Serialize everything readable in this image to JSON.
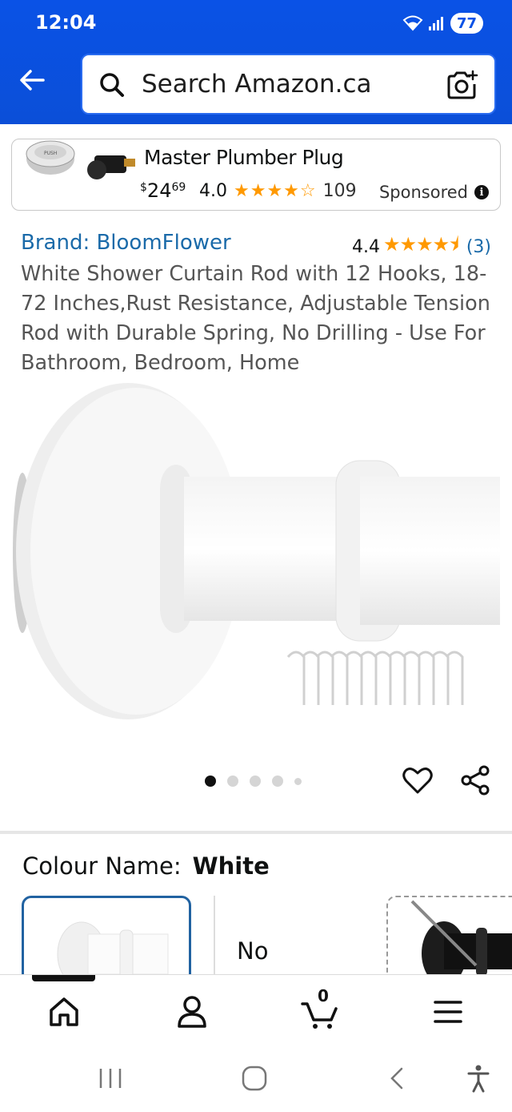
{
  "status": {
    "time": "12:04",
    "battery": "77"
  },
  "search": {
    "placeholder": "Search Amazon.ca"
  },
  "sponsored_ad": {
    "title": "Master Plumber Plug",
    "price_currency": "$",
    "price_whole": "24",
    "price_fraction": "69",
    "rating": "4.0",
    "stars": "★★★★☆",
    "review_count": "109",
    "sponsored_label": "Sponsored",
    "info_glyph": "i"
  },
  "product": {
    "brand": "Brand: BloomFlower",
    "rating": "4.4",
    "stars": "★★★★⯨",
    "review_count": "(3)",
    "title": "White Shower Curtain Rod with 12 Hooks, 18-72 Inches,Rust Resistance, Adjustable Tension Rod with Durable Spring, No Drilling - Use For Bathroom, Bedroom, Home",
    "image_count": 5,
    "active_image_index": 0
  },
  "variation": {
    "label": "Colour Name:",
    "selected": "White",
    "option_2_label": "No"
  },
  "bottom_nav": {
    "items": [
      "home-icon",
      "account-icon",
      "cart-icon",
      "menu-icon"
    ],
    "cart_count": "0"
  },
  "colors": {
    "header_blue": "#0a52e6",
    "link_blue": "#1a6aa9",
    "star_orange": "#ff9900",
    "selected_border": "#2162a1"
  }
}
